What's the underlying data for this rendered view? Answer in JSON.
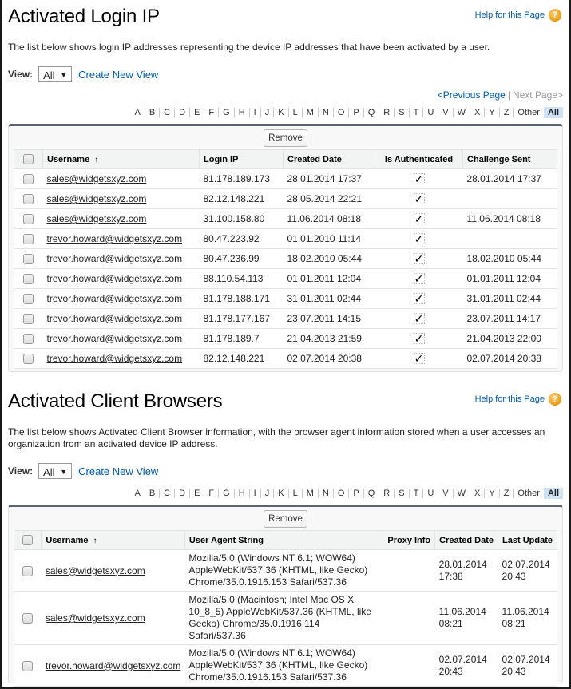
{
  "login_ip": {
    "title": "Activated Login IP",
    "help_label": "Help for this Page",
    "description": "The list below shows login IP addresses representing the device IP addresses that have been activated by a user.",
    "view_label": "View:",
    "view_selected": "All",
    "create_view_label": "Create New View",
    "pager": {
      "prev": "<Previous Page",
      "separator": "|",
      "next": "Next Page>"
    },
    "remove_label": "Remove",
    "columns": [
      "Username",
      "Login IP",
      "Created Date",
      "Is Authenticated",
      "Challenge Sent"
    ],
    "sort_indicator": "↑",
    "rows": [
      {
        "username": "sales@widgetsxyz.com",
        "ip": "81.178.189.173",
        "created": "28.01.2014 17:37",
        "authenticated": true,
        "challenge": "28.01.2014 17:37"
      },
      {
        "username": "sales@widgetsxyz.com",
        "ip": "82.12.148.221",
        "created": "28.05.2014 22:21",
        "authenticated": true,
        "challenge": ""
      },
      {
        "username": "sales@widgetsxyz.com",
        "ip": "31.100.158.80",
        "created": "11.06.2014 08:18",
        "authenticated": true,
        "challenge": "11.06.2014 08:18"
      },
      {
        "username": "trevor.howard@widgetsxyz.com",
        "ip": "80.47.223.92",
        "created": "01.01.2010 11:14",
        "authenticated": true,
        "challenge": ""
      },
      {
        "username": "trevor.howard@widgetsxyz.com",
        "ip": "80.47.236.99",
        "created": "18.02.2010 05:44",
        "authenticated": true,
        "challenge": "18.02.2010 05:44"
      },
      {
        "username": "trevor.howard@widgetsxyz.com",
        "ip": "88.110.54.113",
        "created": "01.01.2011 12:04",
        "authenticated": true,
        "challenge": "01.01.2011 12:04"
      },
      {
        "username": "trevor.howard@widgetsxyz.com",
        "ip": "81.178.188.171",
        "created": "31.01.2011 02:44",
        "authenticated": true,
        "challenge": "31.01.2011 02:44"
      },
      {
        "username": "trevor.howard@widgetsxyz.com",
        "ip": "81.178.177.167",
        "created": "23.07.2011 14:15",
        "authenticated": true,
        "challenge": "23.07.2011 14:17"
      },
      {
        "username": "trevor.howard@widgetsxyz.com",
        "ip": "81.178.189.7",
        "created": "21.04.2013 21:59",
        "authenticated": true,
        "challenge": "21.04.2013 22:00"
      },
      {
        "username": "trevor.howard@widgetsxyz.com",
        "ip": "82.12.148.221",
        "created": "02.07.2014 20:38",
        "authenticated": true,
        "challenge": "02.07.2014 20:38"
      }
    ]
  },
  "client_browsers": {
    "title": "Activated Client Browsers",
    "help_label": "Help for this Page",
    "description": "The list below shows Activated Client Browser information, with the browser agent information stored when a user accesses an organization from an activated device IP address.",
    "view_label": "View:",
    "view_selected": "All",
    "create_view_label": "Create New View",
    "remove_label": "Remove",
    "columns": [
      "Username",
      "User Agent String",
      "Proxy Info",
      "Created Date",
      "Last Update"
    ],
    "sort_indicator": "↑",
    "rows": [
      {
        "username": "sales@widgetsxyz.com",
        "agent": "Mozilla/5.0 (Windows NT 6.1; WOW64) AppleWebKit/537.36 (KHTML, like Gecko) Chrome/35.0.1916.153 Safari/537.36",
        "proxy": "",
        "created": "28.01.2014 17:38",
        "updated": "02.07.2014 20:43"
      },
      {
        "username": "sales@widgetsxyz.com",
        "agent": "Mozilla/5.0 (Macintosh; Intel Mac OS X 10_8_5) AppleWebKit/537.36 (KHTML, like Gecko) Chrome/35.0.1916.114 Safari/537.36",
        "proxy": "",
        "created": "11.06.2014 08:21",
        "updated": "11.06.2014 08:21"
      },
      {
        "username": "trevor.howard@widgetsxyz.com",
        "agent": "Mozilla/5.0 (Windows NT 6.1; WOW64) AppleWebKit/537.36 (KHTML, like Gecko) Chrome/35.0.1916.153 Safari/537.36",
        "proxy": "",
        "created": "02.07.2014 20:43",
        "updated": "02.07.2014 20:43"
      }
    ]
  },
  "alpha_filter": {
    "letters": [
      "A",
      "B",
      "C",
      "D",
      "E",
      "F",
      "G",
      "H",
      "I",
      "J",
      "K",
      "L",
      "M",
      "N",
      "O",
      "P",
      "Q",
      "R",
      "S",
      "T",
      "U",
      "V",
      "W",
      "X",
      "Y",
      "Z",
      "Other"
    ],
    "selected": "All"
  },
  "icons": {
    "help": "help-question-icon",
    "dropdown": "chevron-down-icon",
    "sort": "sort-ascending-icon",
    "check": "checkmark-icon"
  },
  "colors": {
    "link": "#015ba7",
    "panel_top_border": "#5a6372",
    "alpha_selected_bg": "#cfe3f6",
    "help_icon": "#e89a12"
  }
}
